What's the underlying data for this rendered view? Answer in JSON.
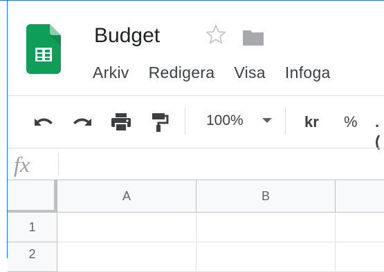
{
  "document": {
    "title": "Budget",
    "icons": {
      "logo": "google-sheets-logo",
      "star": "star-outline-icon",
      "folder": "folder-icon"
    }
  },
  "menu": {
    "items": [
      {
        "label": "Arkiv"
      },
      {
        "label": "Redigera"
      },
      {
        "label": "Visa"
      },
      {
        "label": "Infoga"
      }
    ]
  },
  "toolbar": {
    "icons": [
      "undo-icon",
      "redo-icon",
      "print-icon",
      "paint-format-icon"
    ],
    "zoom": "100%",
    "currency": "kr",
    "percent": "%",
    "decimal": ".("
  },
  "formula_bar": {
    "label": "fx",
    "value": ""
  },
  "sheet": {
    "columns": [
      "A",
      "B"
    ],
    "rows": [
      "1",
      "2"
    ]
  },
  "colors": {
    "accent": "#1a73e8",
    "sheets_green": "#0f9d58",
    "grey_icon": "#5f6368"
  }
}
